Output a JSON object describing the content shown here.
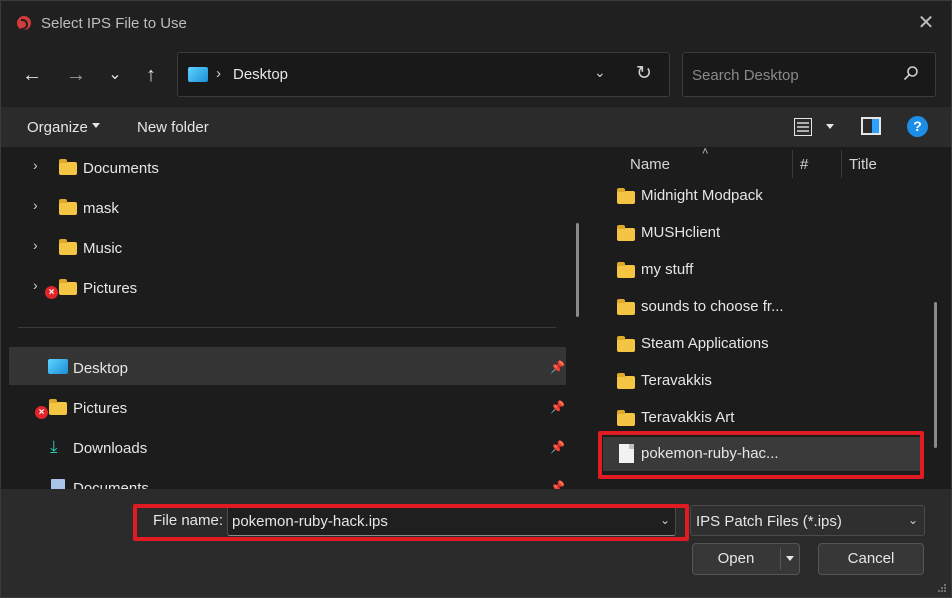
{
  "window": {
    "title": "Select IPS File to Use",
    "close_glyph": "✕"
  },
  "nav": {
    "back_glyph": "←",
    "forward_glyph": "→",
    "recent_glyph": "⌄",
    "up_glyph": "↑",
    "address": {
      "separator": "›",
      "location": "Desktop",
      "dropdown_glyph": "⌄",
      "refresh_glyph": "↻"
    },
    "search": {
      "placeholder": "Search Desktop"
    }
  },
  "toolbar": {
    "organize_label": "Organize",
    "new_folder_label": "New folder",
    "help_glyph": "?"
  },
  "tree": {
    "chevron_glyph": "›",
    "error_glyph": "×",
    "pin_glyph": "📌",
    "items": [
      {
        "label": "Documents"
      },
      {
        "label": "mask"
      },
      {
        "label": "Music"
      },
      {
        "label": "Pictures"
      }
    ],
    "quick_access": [
      {
        "label": "Desktop"
      },
      {
        "label": "Pictures"
      },
      {
        "label": "Downloads",
        "icon_glyph": "⤓"
      },
      {
        "label": "Documents"
      }
    ]
  },
  "file_list": {
    "columns": {
      "name": "Name",
      "number": "#",
      "title": "Title",
      "sort_glyph": "˄"
    },
    "items": [
      {
        "label": "Midnight Modpack",
        "type": "folder"
      },
      {
        "label": "MUSHclient",
        "type": "folder"
      },
      {
        "label": "my stuff",
        "type": "folder"
      },
      {
        "label": "sounds to choose fr...",
        "type": "folder"
      },
      {
        "label": "Steam Applications",
        "type": "folder"
      },
      {
        "label": "Teravakkis",
        "type": "folder"
      },
      {
        "label": "Teravakkis Art",
        "type": "folder"
      },
      {
        "label": "pokemon-ruby-hac...",
        "type": "file",
        "selected": true
      }
    ]
  },
  "bottom": {
    "file_name_label": "File name:",
    "file_name_value": "pokemon-ruby-hack.ips",
    "dropdown_glyph": "⌄",
    "file_type_value": "IPS Patch Files (*.ips)",
    "open_label": "Open",
    "cancel_label": "Cancel"
  },
  "colors": {
    "highlight": "#e11b22",
    "accent": "#1c8ee8",
    "folder": "#f4c542"
  }
}
